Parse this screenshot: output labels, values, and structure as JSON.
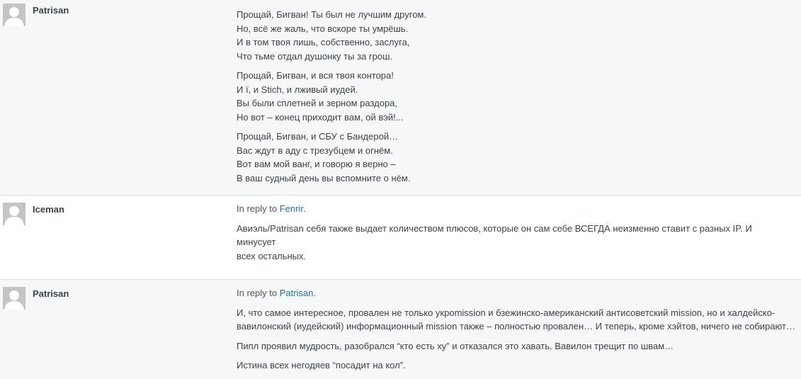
{
  "replies": [
    {
      "author": "Patrisan",
      "stanzas": [
        "Прощай, Бигван! Ты был не лучшим другом.\nНо, всё же жаль, что вскоре ты умрёшь.\nИ в том твоя лишь, собственно, заслуга,\nЧто тьме отдал душонку ты за грош.",
        "Прощай, Бигван, и вся твоя контора!\nИ ї, и Stich, и лживый иудей.\nВы были сплетней и зерном раздора,\nНо вот – конец приходит вам, ой вэй!...",
        "Прощай, Бигван, и СБУ с Бандерой…\nВас ждут в аду с трезубцем и огнём.\nВот вам мой ванг, и говорю я верно –\nВ ваш судный день вы вспомните о нём."
      ]
    },
    {
      "author": "Iceman",
      "in_reply_prefix": "In reply to ",
      "in_reply_to": "Fenrir",
      "in_reply_suffix": ".",
      "paragraphs": [
        "Авиэль/Patrisan себя также выдает количеством плюсов, которые он сам себе ВСЕГДА неизменно ставит с разных IP. И минусует\nвсех остальных."
      ]
    },
    {
      "author": "Patrisan",
      "in_reply_prefix": "In reply to ",
      "in_reply_to": "Patrisan",
      "in_reply_suffix": ".",
      "paragraphs": [
        "И, что самое интересное, провален не только укроmission и бзежинско-американский антисоветский mission, но и халдейско-\nвавилонский (иудейский) информационный mission также – полностью провален… И теперь, кроме хэйтов, ничего не собирают…",
        "Пипл проявил мудрость, разобрался “кто есть ху” и отказался это хавать. Вавилон трещит по швам…",
        "Истина всех негодяев “посадит на кол”."
      ]
    }
  ],
  "colors": {
    "alt_row_bg": "#f6f7f7",
    "link": "#2271b1",
    "text": "#3c434a",
    "avatar": "#c4c4c4"
  },
  "icons": {
    "avatar": "default-user-avatar-icon"
  }
}
